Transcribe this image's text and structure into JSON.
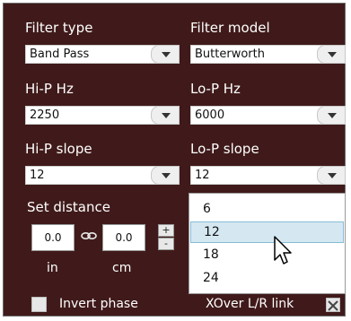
{
  "filter_type": {
    "label": "Filter type",
    "value": "Band Pass"
  },
  "filter_model": {
    "label": "Filter model",
    "value": "Butterworth"
  },
  "hi_p_hz": {
    "label": "Hi-P Hz",
    "value": "2250"
  },
  "lo_p_hz": {
    "label": "Lo-P Hz",
    "value": "6000"
  },
  "hi_p_slope": {
    "label": "Hi-P slope",
    "value": "12"
  },
  "lo_p_slope": {
    "label": "Lo-P slope",
    "value": "12",
    "options": [
      "6",
      "12",
      "18",
      "24"
    ],
    "highlighted": "12"
  },
  "distance": {
    "label": "Set distance",
    "in_value": "0.0",
    "cm_value": "0.0",
    "in_unit": "in",
    "cm_unit": "cm",
    "plus": "+",
    "minus": "-"
  },
  "invert_phase": {
    "label": "Invert phase",
    "checked": false
  },
  "xover_link": {
    "label": "XOver L/R link",
    "checked": true
  },
  "colors": {
    "panel_bg": "#401a1a",
    "selection": "#d5e8f2",
    "selection_border": "#86bcd8"
  },
  "icons": {
    "chain": "chain-link-icon",
    "dropdown": "chevron-down-icon",
    "pointer": "mouse-pointer-icon"
  }
}
